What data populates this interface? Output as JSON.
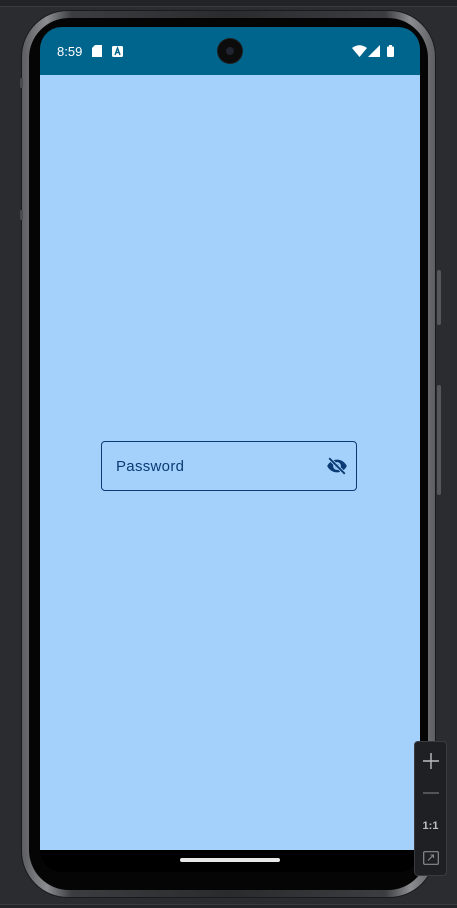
{
  "status_bar": {
    "time": "8:59",
    "icons": [
      "sd-card-icon",
      "app-notification-icon",
      "wifi-icon",
      "signal-icon",
      "battery-icon"
    ],
    "background": "#00658c"
  },
  "app": {
    "background": "#a4d1fc",
    "password_field": {
      "label": "Password",
      "trailing_icon": "visibility-off-icon",
      "accent": "#0b3b74"
    }
  },
  "zoom_controls": {
    "zoom_in": "+",
    "zoom_out": "—",
    "actual_size": "1:1",
    "fit_screen": "fit-screen-icon"
  }
}
